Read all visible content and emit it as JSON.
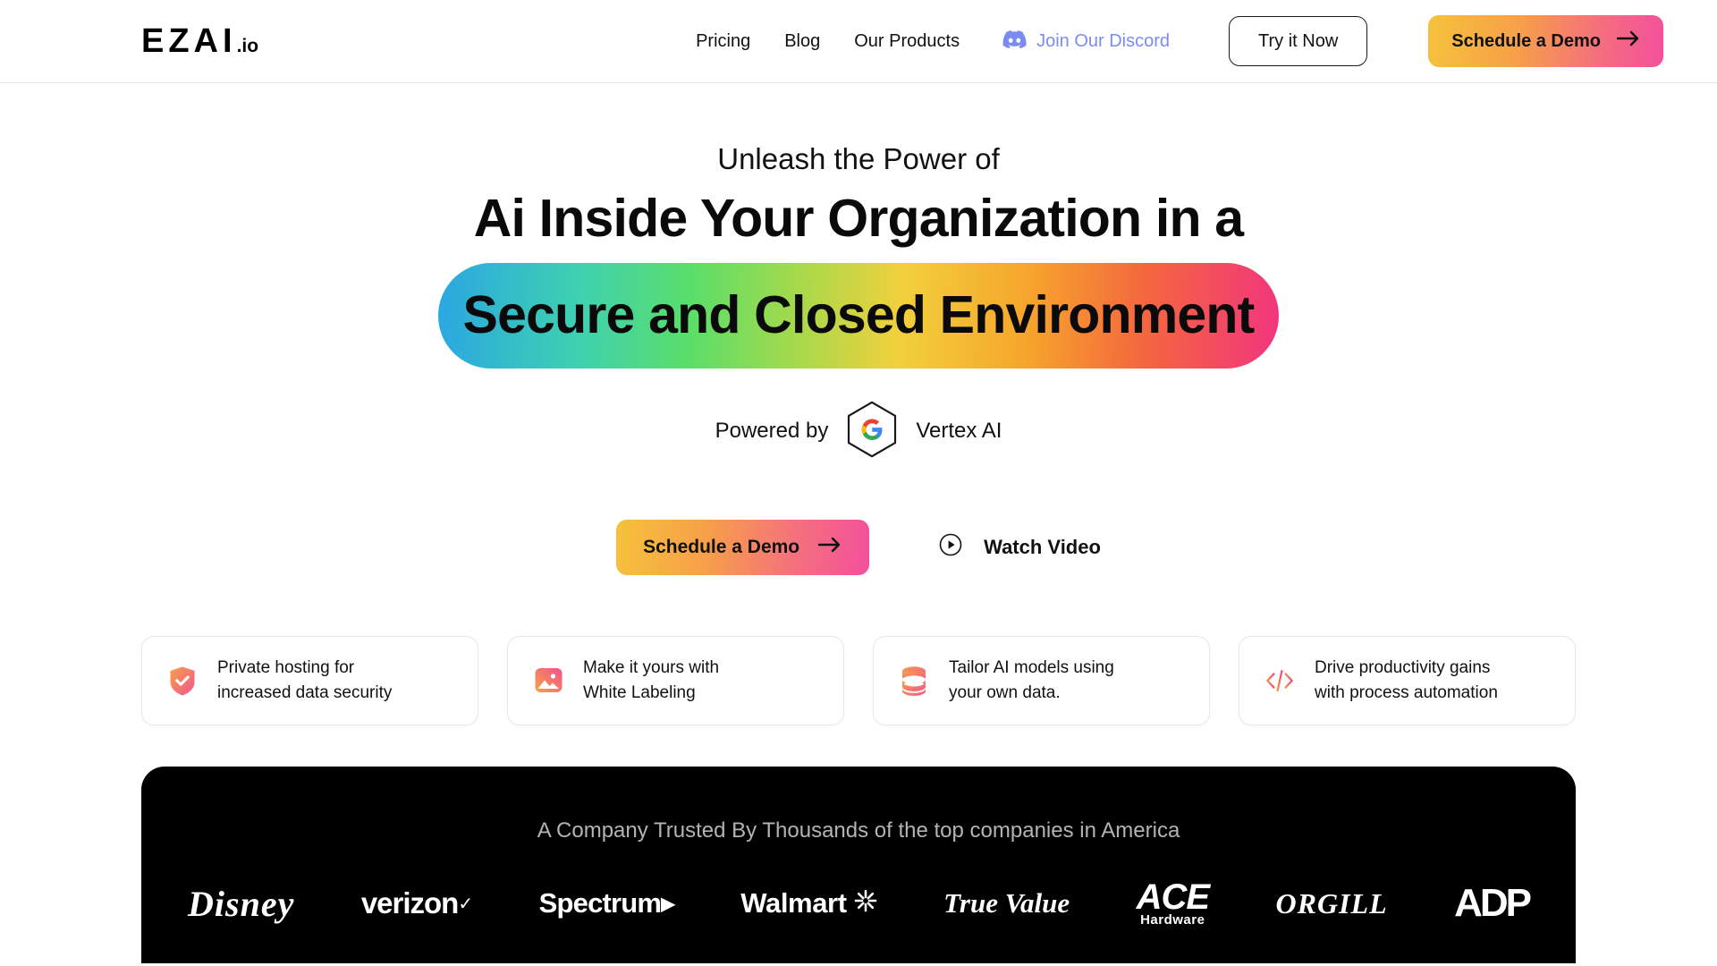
{
  "header": {
    "logo_main": "EZAI",
    "logo_suffix": ".io",
    "nav": [
      {
        "label": "Pricing"
      },
      {
        "label": "Blog"
      },
      {
        "label": "Our Products"
      }
    ],
    "discord_label": "Join Our Discord",
    "discord_color": "#7b8cf0",
    "try_it_now_label": "Try it Now",
    "schedule_demo_label": "Schedule a Demo"
  },
  "hero": {
    "eyebrow": "Unleash the Power of",
    "headline": "Ai Inside Your Organization in a",
    "highlight": "Secure and Closed Environment",
    "powered_by_label": "Powered by",
    "provider": "Vertex AI",
    "cta_primary": "Schedule a Demo",
    "cta_secondary": "Watch Video"
  },
  "features": [
    {
      "icon": "shield-check-icon",
      "text_line1": "Private hosting for",
      "text_line2": "increased data security"
    },
    {
      "icon": "image-icon",
      "text_line1": "Make it yours with",
      "text_line2": "White Labeling"
    },
    {
      "icon": "database-icon",
      "text_line1": "Tailor AI models using",
      "text_line2": "your own data."
    },
    {
      "icon": "code-icon",
      "text_line1": "Drive productivity gains",
      "text_line2": "with process automation"
    }
  ],
  "trusted": {
    "title": "A Company Trusted By Thousands of the top companies in America",
    "logos": [
      {
        "name": "Disney"
      },
      {
        "name": "verizon"
      },
      {
        "name": "Spectrum"
      },
      {
        "name": "Walmart"
      },
      {
        "name": "True Value"
      },
      {
        "name": "ACE",
        "sub": "Hardware"
      },
      {
        "name": "ORGILL"
      },
      {
        "name": "ADP"
      }
    ]
  },
  "colors": {
    "gradient_start": "#f5c23c",
    "gradient_end": "#f4509c",
    "band_blue": "#2aa7e2",
    "band_green": "#5ade6a",
    "band_yellow": "#f2d03c",
    "band_orange": "#f6a52c",
    "band_pink": "#f2357e",
    "dark_section": "#000000"
  }
}
